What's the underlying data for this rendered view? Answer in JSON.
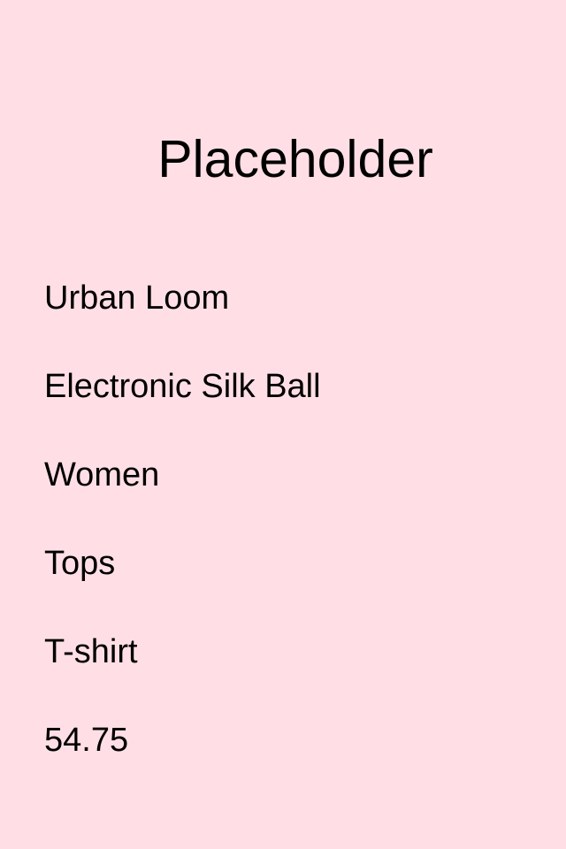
{
  "theme": {
    "background": "#FFDFE5",
    "text": "#000000"
  },
  "title": "Placeholder",
  "product": {
    "brand": "Urban Loom",
    "name": "Electronic Silk Ball",
    "gender": "Women",
    "category": "Tops",
    "type": "T-shirt",
    "price": "54.75"
  }
}
